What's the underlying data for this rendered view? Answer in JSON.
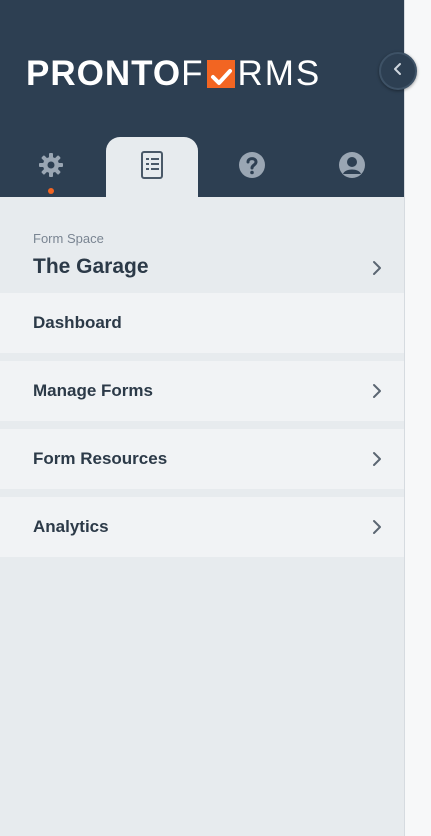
{
  "brand": {
    "logo_text_bold": "PRONTO",
    "logo_text_f": "F",
    "logo_text_rest": "RMS",
    "accent_color": "#f26522",
    "header_color": "#2d3f52"
  },
  "tabs": [
    {
      "icon": "gear-icon",
      "active": false,
      "indicator": true
    },
    {
      "icon": "form-list-icon",
      "active": true,
      "indicator": false
    },
    {
      "icon": "help-icon",
      "active": false,
      "indicator": false
    },
    {
      "icon": "user-icon",
      "active": false,
      "indicator": false
    }
  ],
  "form_space": {
    "label": "Form Space",
    "name": "The Garage"
  },
  "menu": {
    "items": [
      {
        "label": "Dashboard",
        "has_chevron": false
      },
      {
        "label": "Manage Forms",
        "has_chevron": true
      },
      {
        "label": "Form Resources",
        "has_chevron": true
      },
      {
        "label": "Analytics",
        "has_chevron": true
      }
    ]
  }
}
